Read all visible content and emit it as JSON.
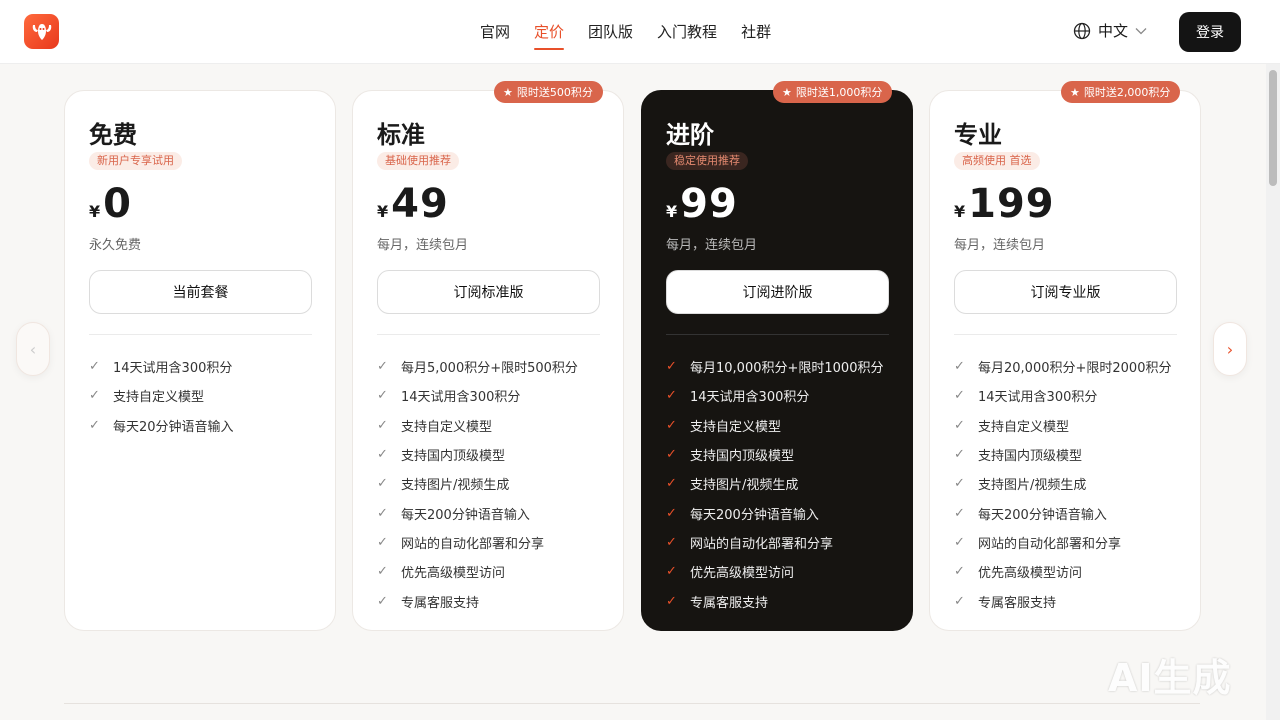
{
  "header": {
    "nav": [
      "官网",
      "定价",
      "团队版",
      "入门教程",
      "社群"
    ],
    "active_nav": "定价",
    "language": "中文",
    "login_label": "登录"
  },
  "colors": {
    "accent": "#e8502a",
    "badge": "#d9654b",
    "dark_card": "#161411"
  },
  "plans": [
    {
      "name": "免费",
      "tag": "新用户专享试用",
      "currency": "¥",
      "price": "0",
      "period": "永久免费",
      "cta": "当前套餐",
      "badge": "",
      "features": [
        "14天试用含300积分",
        "支持自定义模型",
        "每天20分钟语音输入"
      ]
    },
    {
      "name": "标准",
      "tag": "基础使用推荐",
      "currency": "¥",
      "price": "49",
      "period": "每月，连续包月",
      "cta": "订阅标准版",
      "badge": "限时送500积分",
      "features": [
        "每月5,000积分+限时500积分",
        "14天试用含300积分",
        "支持自定义模型",
        "支持国内顶级模型",
        "支持图片/视频生成",
        "每天200分钟语音输入",
        "网站的自动化部署和分享",
        "优先高级模型访问",
        "专属客服支持"
      ]
    },
    {
      "name": "进阶",
      "tag": "稳定使用推荐",
      "currency": "¥",
      "price": "99",
      "period": "每月，连续包月",
      "cta": "订阅进阶版",
      "badge": "限时送1,000积分",
      "features": [
        "每月10,000积分+限时1000积分",
        "14天试用含300积分",
        "支持自定义模型",
        "支持国内顶级模型",
        "支持图片/视频生成",
        "每天200分钟语音输入",
        "网站的自动化部署和分享",
        "优先高级模型访问",
        "专属客服支持"
      ]
    },
    {
      "name": "专业",
      "tag": "高频使用 首选",
      "currency": "¥",
      "price": "199",
      "period": "每月，连续包月",
      "cta": "订阅专业版",
      "badge": "限时送2,000积分",
      "features": [
        "每月20,000积分+限时2000积分",
        "14天试用含300积分",
        "支持自定义模型",
        "支持国内顶级模型",
        "支持图片/视频生成",
        "每天200分钟语音输入",
        "网站的自动化部署和分享",
        "优先高级模型访问",
        "专属客服支持"
      ]
    }
  ],
  "watermark": "AI生成"
}
